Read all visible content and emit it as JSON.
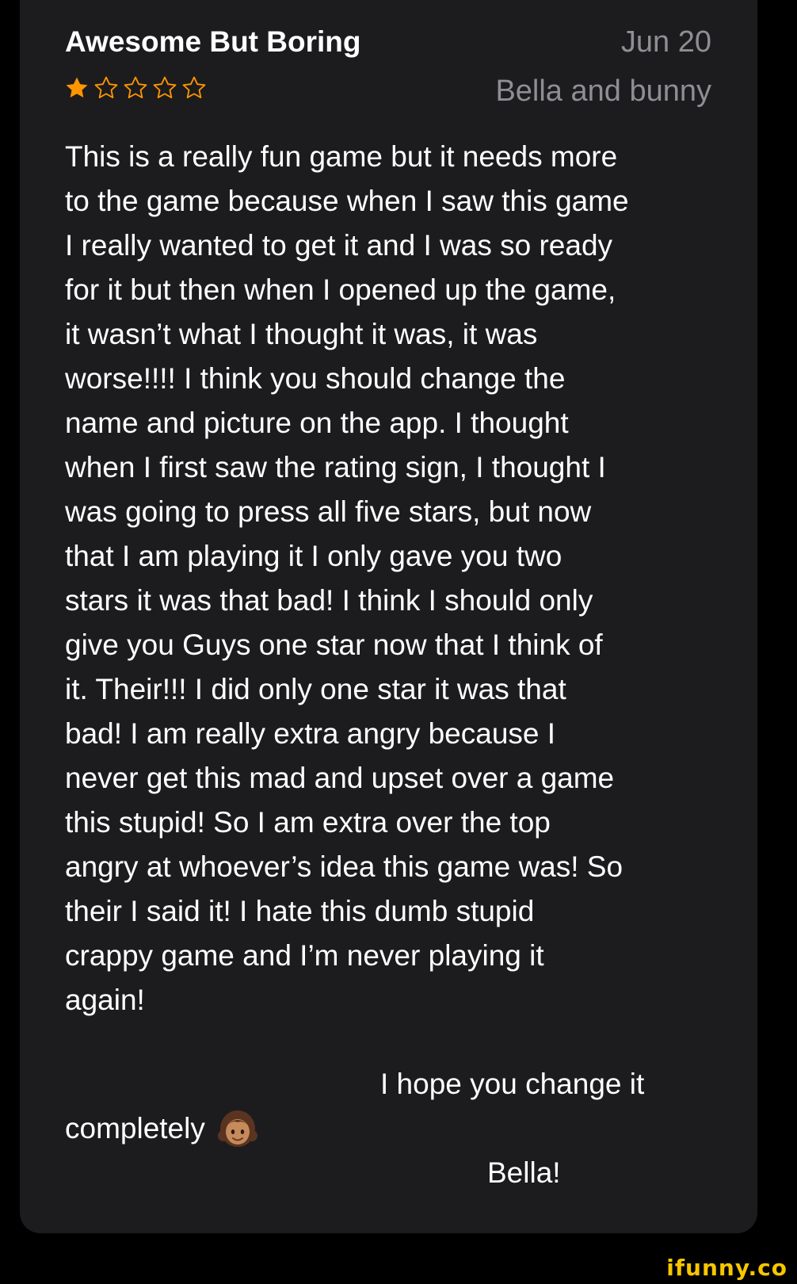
{
  "review": {
    "title": "Awesome But Boring",
    "date": "Jun 20",
    "author": "Bella and bunny",
    "rating": 1,
    "rating_max": 5,
    "star_color": "#ff9500",
    "body_lines": [
      "This is a really fun game but it needs more",
      "to the game because when I saw this game",
      "I really wanted to get it and I was so ready",
      "for it but then when I opened up the game,",
      "it wasn’t what I thought it was, it was",
      "worse!!!! I think you should change the",
      "name and picture on the app. I thought",
      "when I first saw the rating sign, I thought I",
      "was going to press all five stars, but now",
      "that I am playing it I only gave you two",
      "stars it was that bad! I think I should only",
      "give you Guys one star now that I think of",
      "it. Their!!! I did only one star it was that",
      "bad! I am really extra angry because I",
      "never get this mad and upset over a game",
      "this stupid! So I am extra over the top",
      "angry at whoever’s idea this game was! So",
      "their I said it! I hate this dumb stupid",
      "crappy game and I’m never playing it",
      "again!"
    ],
    "closing_line1": "I hope you change it",
    "closing_line2": "completely",
    "closing_emoji": "girl-emoji",
    "signature": "Bella!"
  },
  "watermark": "ifunny.co"
}
